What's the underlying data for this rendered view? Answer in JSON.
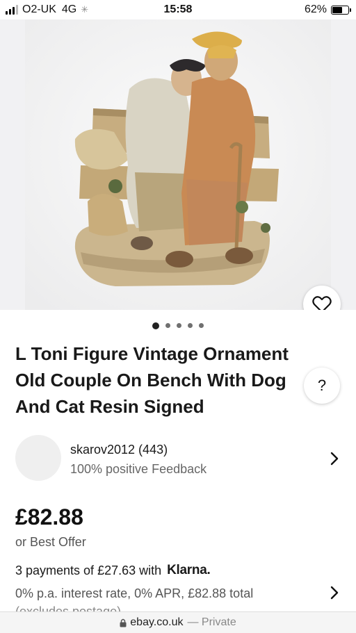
{
  "status_bar": {
    "carrier": "O2-UK",
    "network": "4G",
    "loading_glyph": "✳",
    "time": "15:58",
    "battery": "62%",
    "battery_level": 0.62
  },
  "gallery": {
    "image_count": 5,
    "active_index": 0,
    "favorite_icon": "heart-icon"
  },
  "listing": {
    "title": "L Toni Figure Vintage Ornament Old Couple On Bench With Dog And Cat Resin Signed",
    "help_label": "?"
  },
  "seller": {
    "name": "skarov2012 (443)",
    "feedback": "100% positive Feedback"
  },
  "price": {
    "amount": "£82.88",
    "best_offer": "or Best Offer",
    "payments_text": "3 payments of £27.63 with",
    "klarna": "Klarna.",
    "interest": "0% p.a. interest rate, 0% APR, £82.88 total",
    "postage_note": "(excludes postage)"
  },
  "browser": {
    "url": "ebay.co.uk",
    "mode": "— Private",
    "lock_icon": "lock-icon"
  }
}
